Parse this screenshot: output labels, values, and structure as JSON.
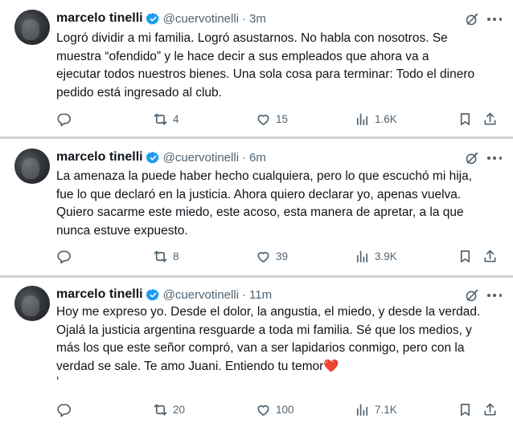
{
  "tweets": [
    {
      "name": "marcelo tinelli",
      "handle": "@cuervotinelli",
      "dot": "·",
      "time": "3m",
      "lines": [
        "Logró dividir a mi familia. Logró asustarnos. No habla con nosotros. Se",
        "muestra “ofendido” y le hace decir a sus empleados que ahora va a",
        "ejecutar todos nuestros bienes. Una sola cosa para terminar: Todo el dinero",
        "pedido está ingresado al club."
      ],
      "replies": "",
      "retweets": "4",
      "likes": "15",
      "views": "1.6K"
    },
    {
      "name": "marcelo tinelli",
      "handle": "@cuervotinelli",
      "dot": "·",
      "time": "6m",
      "lines": [
        "La amenaza la puede haber hecho cualquiera, pero lo que  escuchó mi hija,",
        "fue lo que declaró en la justicia. Ahora quiero declarar yo, apenas vuelva.",
        "Quiero sacarme este miedo, este acoso, esta manera de apretar, a la que",
        "nunca estuve expuesto."
      ],
      "replies": "",
      "retweets": "8",
      "likes": "39",
      "views": "3.9K"
    },
    {
      "name": "marcelo tinelli",
      "handle": "@cuervotinelli",
      "dot": "·",
      "time": "11m",
      "lines": [
        "Hoy me expreso yo. Desde el dolor, la angustia, el miedo, y desde la verdad.",
        "Ojalá la justicia argentina resguarde a toda mi familia. Sé que los medios, y",
        "más los que este señor compró, van a ser lapidarios conmigo, pero con la",
        "verdad se sale. Te amo Juani. Entiendo tu temor",
        "‘"
      ],
      "heart_emoji": "❤️",
      "replies": "",
      "retweets": "20",
      "likes": "100",
      "views": "7.1K"
    }
  ],
  "colors": {
    "text": "#0f1419",
    "secondary": "#536471",
    "verified": "#1d9bf0",
    "heart": "#e0245e",
    "separator": "#cfd4d9"
  },
  "icons": [
    "avatar",
    "verified-badge-icon",
    "grok-icon",
    "more-icon",
    "reply-icon",
    "retweet-icon",
    "like-icon",
    "views-icon",
    "bookmark-icon",
    "share-icon"
  ]
}
